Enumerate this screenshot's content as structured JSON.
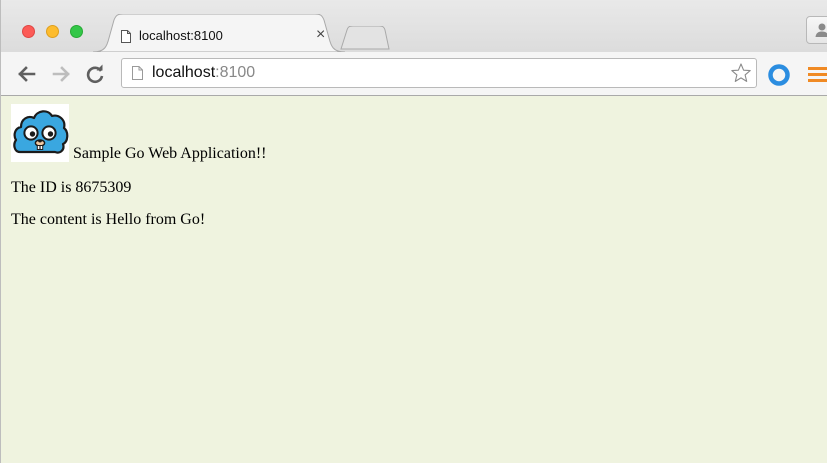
{
  "browser": {
    "tab": {
      "title": "localhost:8100",
      "close_glyph": "×",
      "icon": "page-icon"
    },
    "address_bar": {
      "host": "localhost",
      "port": ":8100"
    },
    "icons": {
      "back": "back-arrow-icon",
      "forward": "forward-arrow-icon",
      "reload": "reload-icon",
      "bookmark": "star-icon",
      "extension": "blue-ring-extension-icon",
      "menu": "hamburger-menu-icon",
      "profile": "profile-icon"
    },
    "colors": {
      "close": "#fc5b57",
      "minimize": "#fdbc2e",
      "zoom": "#33c748",
      "extension": "#2b8de0",
      "menu": "#f08a24"
    }
  },
  "page": {
    "background": "#eff3df",
    "logo": "go-gopher-cloud-logo",
    "title": "Sample Go Web Application!!",
    "id_line": "The ID is 8675309",
    "content_line": "The content is Hello from Go!"
  }
}
